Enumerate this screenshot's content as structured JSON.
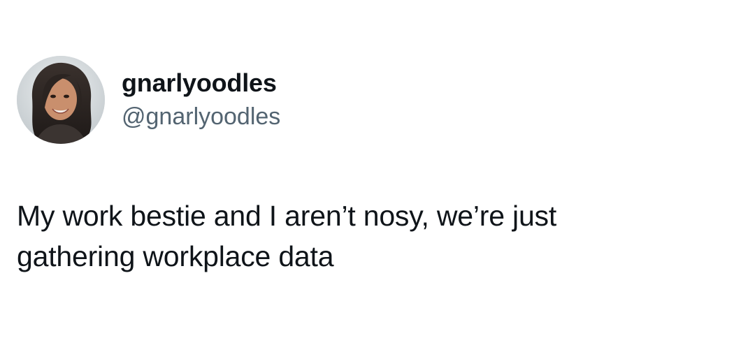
{
  "tweet": {
    "display_name": "gnarlyoodles",
    "handle": "@gnarlyoodles",
    "text": "My work bestie and I aren’t nosy, we’re just\ngathering workplace data"
  },
  "colors": {
    "background": "#ffffff",
    "text_primary": "#0f1419",
    "text_secondary": "#536471"
  },
  "icons": {
    "avatar": "profile-photo"
  }
}
